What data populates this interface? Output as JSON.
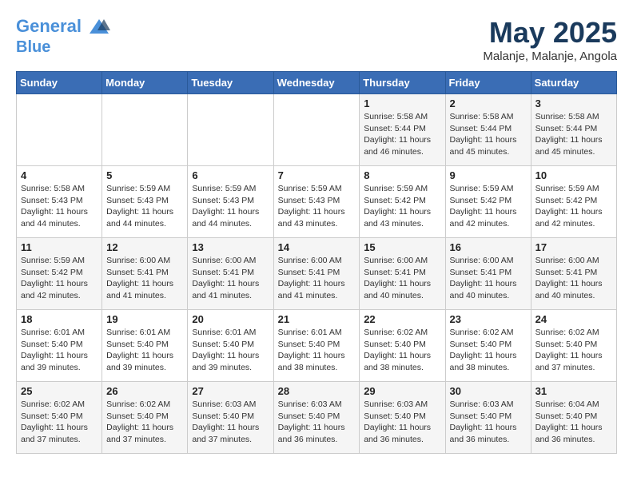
{
  "header": {
    "logo_line1": "General",
    "logo_line2": "Blue",
    "month_title": "May 2025",
    "subtitle": "Malanje, Malanje, Angola"
  },
  "weekdays": [
    "Sunday",
    "Monday",
    "Tuesday",
    "Wednesday",
    "Thursday",
    "Friday",
    "Saturday"
  ],
  "weeks": [
    [
      {
        "day": "",
        "info": ""
      },
      {
        "day": "",
        "info": ""
      },
      {
        "day": "",
        "info": ""
      },
      {
        "day": "",
        "info": ""
      },
      {
        "day": "1",
        "info": "Sunrise: 5:58 AM\nSunset: 5:44 PM\nDaylight: 11 hours\nand 46 minutes."
      },
      {
        "day": "2",
        "info": "Sunrise: 5:58 AM\nSunset: 5:44 PM\nDaylight: 11 hours\nand 45 minutes."
      },
      {
        "day": "3",
        "info": "Sunrise: 5:58 AM\nSunset: 5:44 PM\nDaylight: 11 hours\nand 45 minutes."
      }
    ],
    [
      {
        "day": "4",
        "info": "Sunrise: 5:58 AM\nSunset: 5:43 PM\nDaylight: 11 hours\nand 44 minutes."
      },
      {
        "day": "5",
        "info": "Sunrise: 5:59 AM\nSunset: 5:43 PM\nDaylight: 11 hours\nand 44 minutes."
      },
      {
        "day": "6",
        "info": "Sunrise: 5:59 AM\nSunset: 5:43 PM\nDaylight: 11 hours\nand 44 minutes."
      },
      {
        "day": "7",
        "info": "Sunrise: 5:59 AM\nSunset: 5:43 PM\nDaylight: 11 hours\nand 43 minutes."
      },
      {
        "day": "8",
        "info": "Sunrise: 5:59 AM\nSunset: 5:42 PM\nDaylight: 11 hours\nand 43 minutes."
      },
      {
        "day": "9",
        "info": "Sunrise: 5:59 AM\nSunset: 5:42 PM\nDaylight: 11 hours\nand 42 minutes."
      },
      {
        "day": "10",
        "info": "Sunrise: 5:59 AM\nSunset: 5:42 PM\nDaylight: 11 hours\nand 42 minutes."
      }
    ],
    [
      {
        "day": "11",
        "info": "Sunrise: 5:59 AM\nSunset: 5:42 PM\nDaylight: 11 hours\nand 42 minutes."
      },
      {
        "day": "12",
        "info": "Sunrise: 6:00 AM\nSunset: 5:41 PM\nDaylight: 11 hours\nand 41 minutes."
      },
      {
        "day": "13",
        "info": "Sunrise: 6:00 AM\nSunset: 5:41 PM\nDaylight: 11 hours\nand 41 minutes."
      },
      {
        "day": "14",
        "info": "Sunrise: 6:00 AM\nSunset: 5:41 PM\nDaylight: 11 hours\nand 41 minutes."
      },
      {
        "day": "15",
        "info": "Sunrise: 6:00 AM\nSunset: 5:41 PM\nDaylight: 11 hours\nand 40 minutes."
      },
      {
        "day": "16",
        "info": "Sunrise: 6:00 AM\nSunset: 5:41 PM\nDaylight: 11 hours\nand 40 minutes."
      },
      {
        "day": "17",
        "info": "Sunrise: 6:00 AM\nSunset: 5:41 PM\nDaylight: 11 hours\nand 40 minutes."
      }
    ],
    [
      {
        "day": "18",
        "info": "Sunrise: 6:01 AM\nSunset: 5:40 PM\nDaylight: 11 hours\nand 39 minutes."
      },
      {
        "day": "19",
        "info": "Sunrise: 6:01 AM\nSunset: 5:40 PM\nDaylight: 11 hours\nand 39 minutes."
      },
      {
        "day": "20",
        "info": "Sunrise: 6:01 AM\nSunset: 5:40 PM\nDaylight: 11 hours\nand 39 minutes."
      },
      {
        "day": "21",
        "info": "Sunrise: 6:01 AM\nSunset: 5:40 PM\nDaylight: 11 hours\nand 38 minutes."
      },
      {
        "day": "22",
        "info": "Sunrise: 6:02 AM\nSunset: 5:40 PM\nDaylight: 11 hours\nand 38 minutes."
      },
      {
        "day": "23",
        "info": "Sunrise: 6:02 AM\nSunset: 5:40 PM\nDaylight: 11 hours\nand 38 minutes."
      },
      {
        "day": "24",
        "info": "Sunrise: 6:02 AM\nSunset: 5:40 PM\nDaylight: 11 hours\nand 37 minutes."
      }
    ],
    [
      {
        "day": "25",
        "info": "Sunrise: 6:02 AM\nSunset: 5:40 PM\nDaylight: 11 hours\nand 37 minutes."
      },
      {
        "day": "26",
        "info": "Sunrise: 6:02 AM\nSunset: 5:40 PM\nDaylight: 11 hours\nand 37 minutes."
      },
      {
        "day": "27",
        "info": "Sunrise: 6:03 AM\nSunset: 5:40 PM\nDaylight: 11 hours\nand 37 minutes."
      },
      {
        "day": "28",
        "info": "Sunrise: 6:03 AM\nSunset: 5:40 PM\nDaylight: 11 hours\nand 36 minutes."
      },
      {
        "day": "29",
        "info": "Sunrise: 6:03 AM\nSunset: 5:40 PM\nDaylight: 11 hours\nand 36 minutes."
      },
      {
        "day": "30",
        "info": "Sunrise: 6:03 AM\nSunset: 5:40 PM\nDaylight: 11 hours\nand 36 minutes."
      },
      {
        "day": "31",
        "info": "Sunrise: 6:04 AM\nSunset: 5:40 PM\nDaylight: 11 hours\nand 36 minutes."
      }
    ]
  ]
}
